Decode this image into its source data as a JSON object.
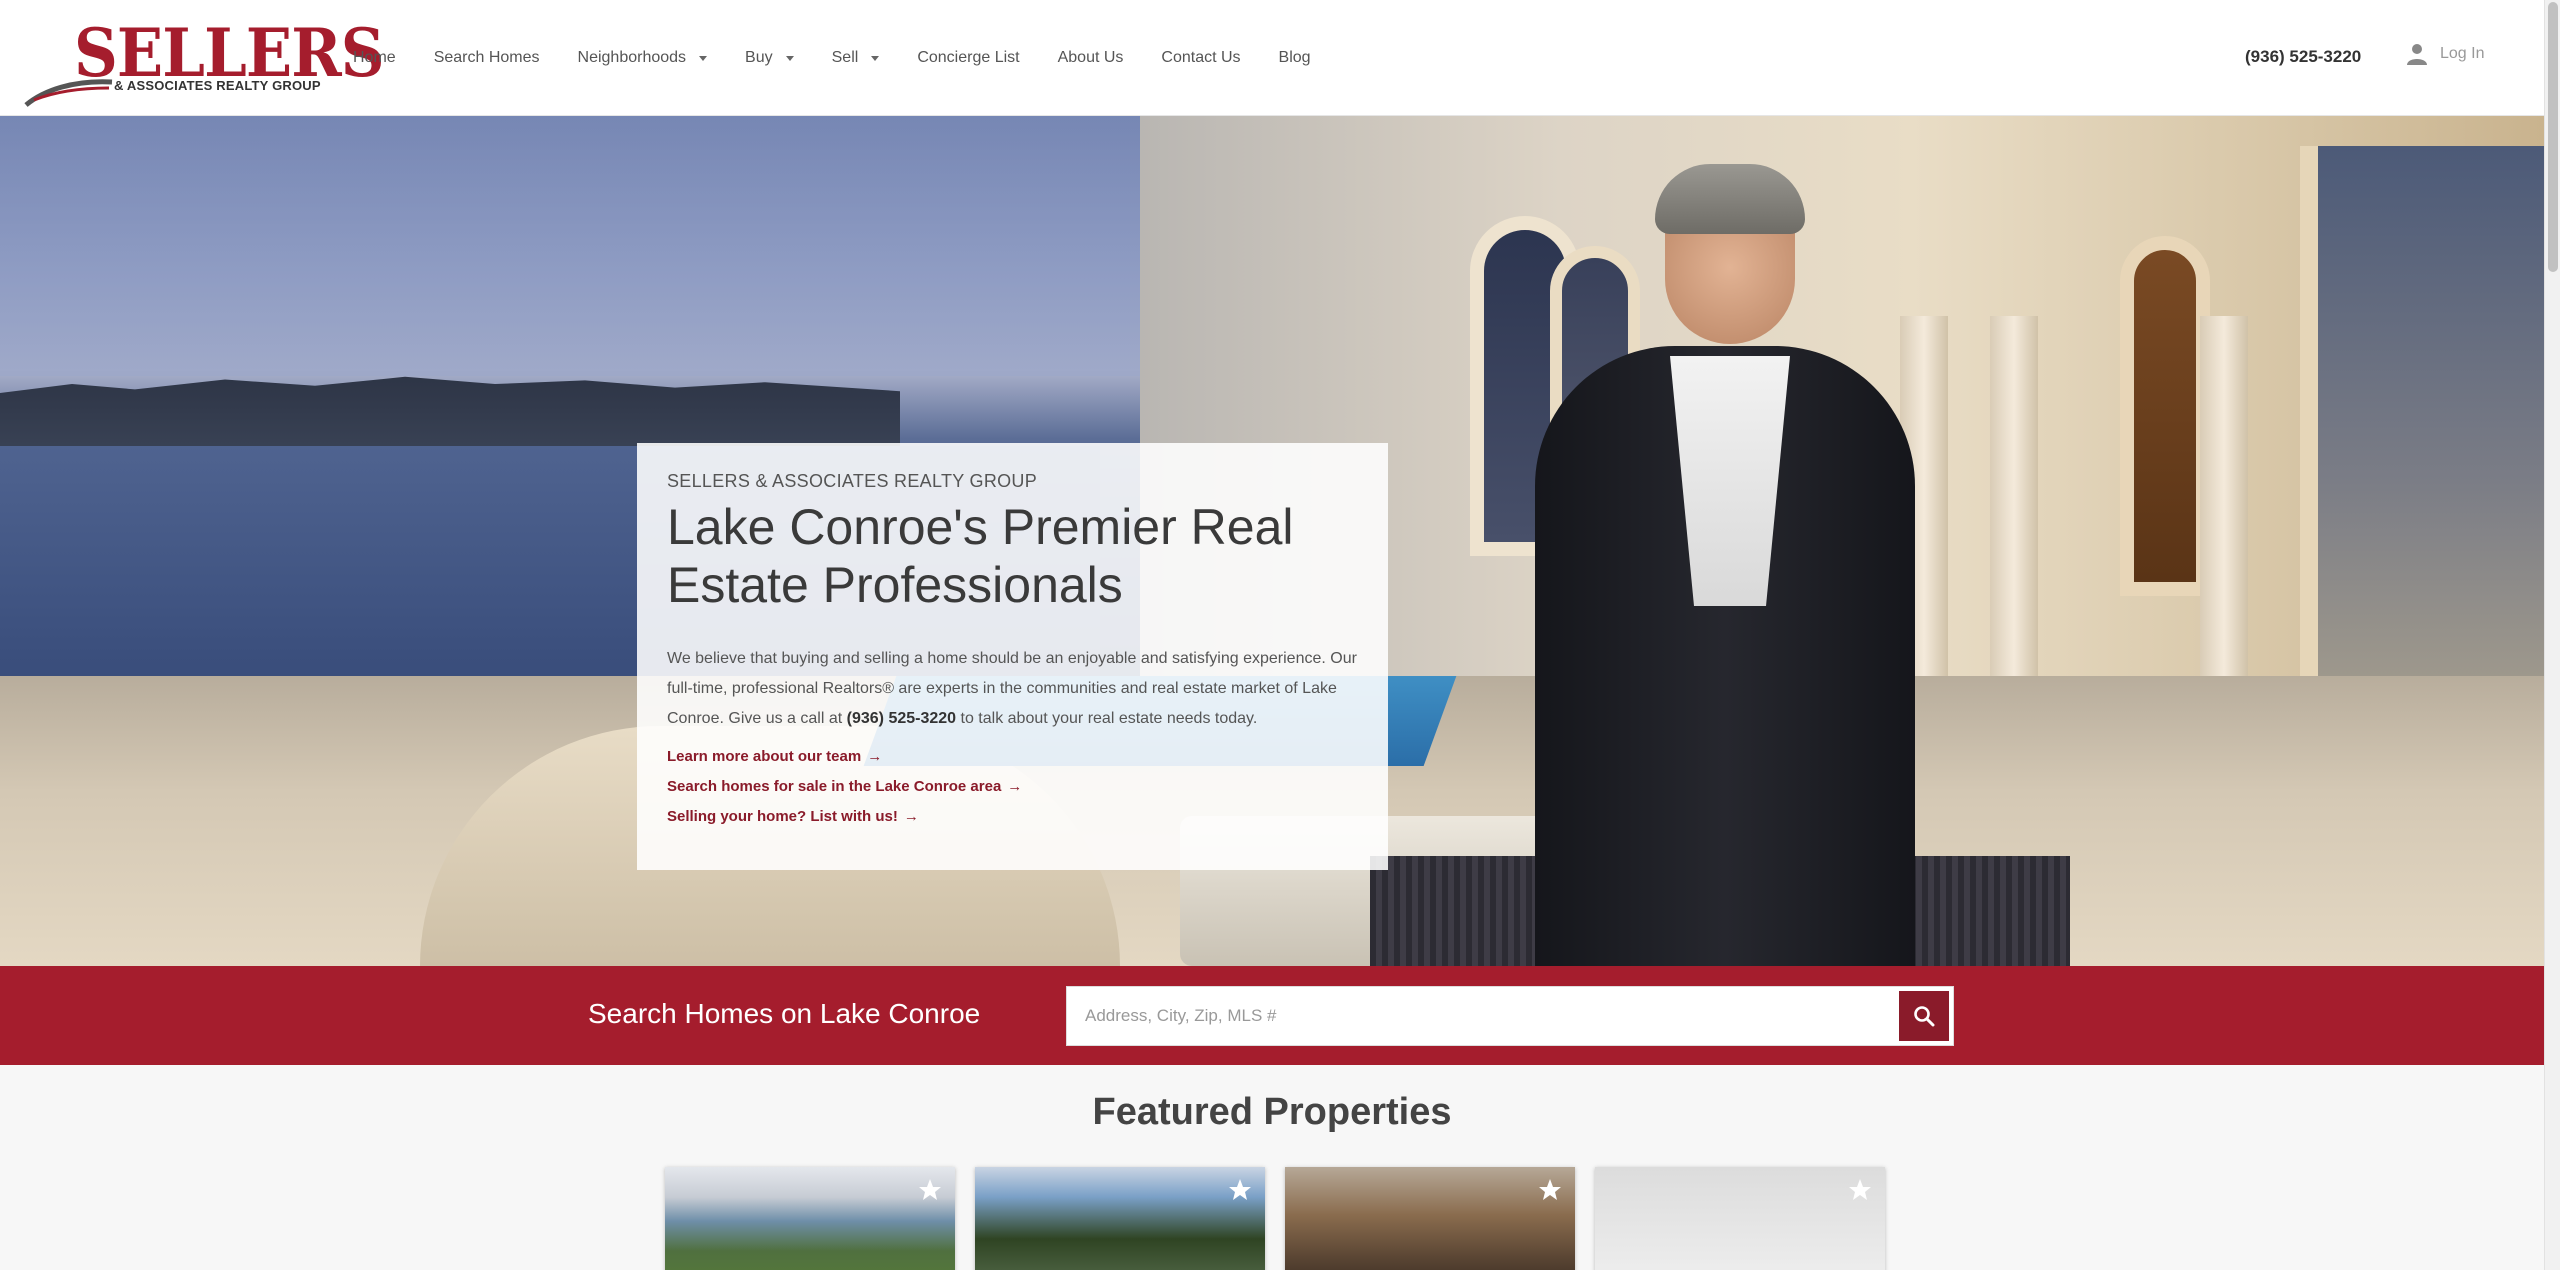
{
  "brand": {
    "logo_main": "SELLERS",
    "logo_sub": "& ASSOCIATES REALTY GROUP",
    "accent_color": "#a51d2d"
  },
  "nav": {
    "items": [
      {
        "label": "Home",
        "dropdown": false
      },
      {
        "label": "Search Homes",
        "dropdown": false
      },
      {
        "label": "Neighborhoods",
        "dropdown": true
      },
      {
        "label": "Buy",
        "dropdown": true
      },
      {
        "label": "Sell",
        "dropdown": true
      },
      {
        "label": "Concierge List",
        "dropdown": false
      },
      {
        "label": "About Us",
        "dropdown": false
      },
      {
        "label": "Contact Us",
        "dropdown": false
      },
      {
        "label": "Blog",
        "dropdown": false
      }
    ],
    "phone": "(936) 525-3220",
    "login_label": "Log In",
    "login_icon": "user-icon"
  },
  "hero": {
    "eyebrow": "SELLERS & ASSOCIATES REALTY GROUP",
    "title": "Lake Conroe's Premier Real Estate Professionals",
    "text_before": "We believe that buying and selling a home should be an enjoyable and satisfying experience. Our full-time, professional Realtors® are experts in the communities and real estate market of Lake Conroe. Give us a call at ",
    "text_phone": "(936) 525-3220",
    "text_after": " to talk about your real estate needs today.",
    "links": [
      {
        "label": "Learn more about our team",
        "arrow": "→"
      },
      {
        "label": "Search homes for sale in the Lake Conroe area",
        "arrow": "→"
      },
      {
        "label": "Selling your home? List with us!",
        "arrow": "→"
      }
    ]
  },
  "search": {
    "label": "Search Homes on Lake Conroe",
    "placeholder": "Address, City, Zip, MLS #",
    "value": "",
    "button_icon": "search-icon"
  },
  "featured": {
    "title": "Featured Properties",
    "favorite_icon": "star-icon"
  }
}
